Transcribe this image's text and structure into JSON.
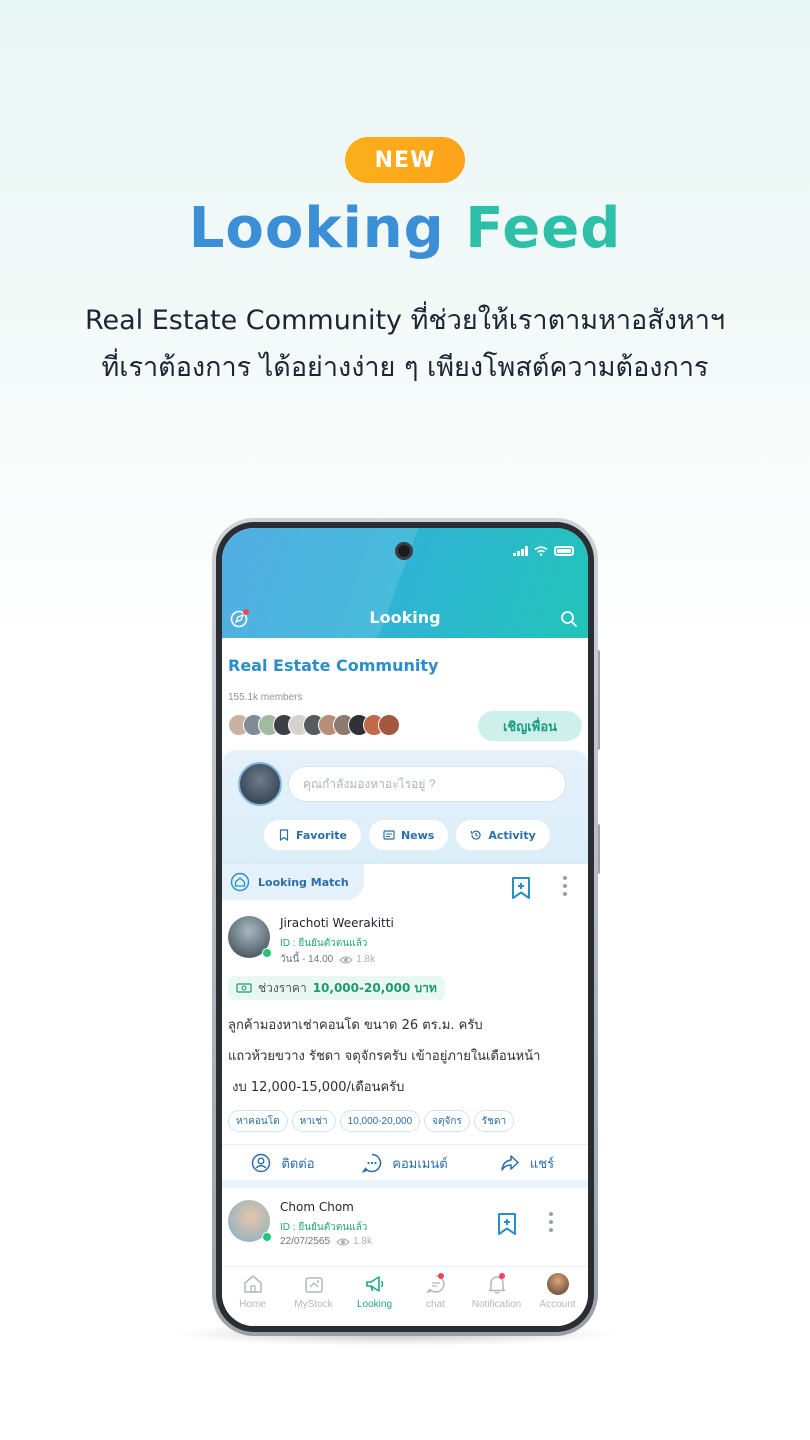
{
  "promo": {
    "badge": "NEW",
    "title_part1": "Looking",
    "title_part2": "Feed",
    "subtitle_line1": "Real Estate Community ที่ช่วยให้เราตามหาอสังหาฯ",
    "subtitle_line2": "ที่เราต้องการ ได้อย่างง่าย ๆ เพียงโพสต์ความต้องการ"
  },
  "app": {
    "header_title": "Looking",
    "community": {
      "name": "Real Estate Community",
      "members": "155.1k members",
      "invite_label": "เชิญเพื่อน"
    },
    "composer": {
      "placeholder": "คุณกำลังมองหาอะไรอยู่ ?",
      "chips": [
        {
          "label": "Favorite",
          "icon": "bookmark-icon"
        },
        {
          "label": "News",
          "icon": "news-icon"
        },
        {
          "label": "Activity",
          "icon": "history-icon"
        }
      ]
    },
    "posts": [
      {
        "tab_label": "Looking Match",
        "author": "Jirachoti Weerakitti",
        "id_status": "ID : ยืนยันตัวตนแล้ว",
        "time": "วันนี้ - 14.00",
        "views": "1.8k",
        "price_label": "ช่วงราคา",
        "price_value": "10,000-20,000 บาท",
        "body_line1": "ลูกค้ามองหาเช่าคอนโด ขนาด 26 ตร.ม. ครับ",
        "body_line2": "แถวห้วยขวาง รัชดา จตุจักรครับ เข้าอยู่ภายในเดือนหน้า",
        "body_line3": " งบ 12,000-15,000/เดือนครับ",
        "tags": [
          "หาคอนโด",
          "หาเช่า",
          "10,000-20,000",
          "จตุจักร",
          "รัชดา"
        ],
        "actions": {
          "contact": "ติดต่อ",
          "comment": "คอมเมนต์",
          "share": "แชร์"
        }
      },
      {
        "author": "Chom Chom",
        "id_status": "ID : ยืนยันตัวตนแล้ว",
        "time": "22/07/2565",
        "views": "1.8k"
      }
    ],
    "bottom_nav": [
      {
        "label": "Home",
        "icon": "home-icon"
      },
      {
        "label": "MyStock",
        "icon": "stock-icon"
      },
      {
        "label": "Looking",
        "icon": "megaphone-icon",
        "active": true
      },
      {
        "label": "chat",
        "icon": "chat-icon",
        "badge": true
      },
      {
        "label": "Notification",
        "icon": "bell-icon",
        "badge": true
      },
      {
        "label": "Account",
        "icon": "avatar"
      }
    ]
  },
  "colors": {
    "accent_blue": "#2a8ec9",
    "accent_teal": "#22c4b9",
    "badge_orange": "#fbb01a",
    "verified_green": "#1ea86e"
  }
}
